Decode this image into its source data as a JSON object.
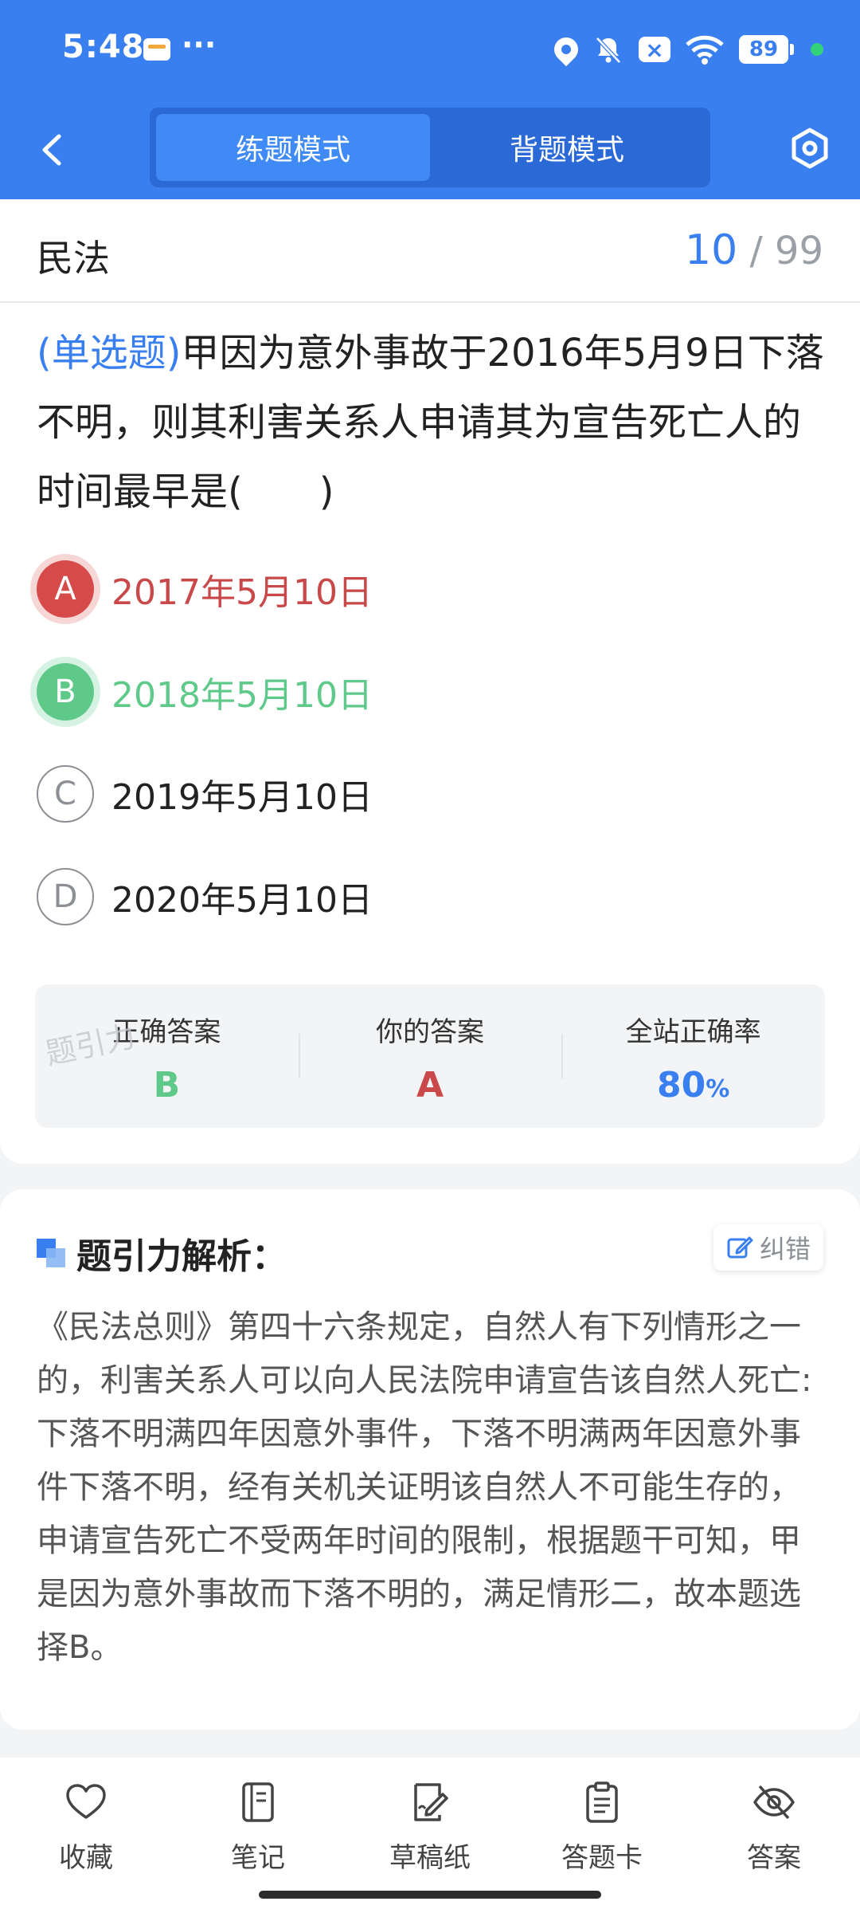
{
  "status_bar": {
    "time": "5:48",
    "more": "···",
    "battery": "89"
  },
  "header": {
    "tabs": [
      {
        "label": "练题模式",
        "active": true
      },
      {
        "label": "背题模式",
        "active": false
      }
    ]
  },
  "question_card": {
    "subject": "民法",
    "progress": {
      "current": "10",
      "separator": "/",
      "total": "99"
    },
    "question_type": "(单选题)",
    "question_text": "甲因为意外事故于2016年5月9日下落不明，则其利害关系人申请其为宣告死亡人的时间最早是(　　)",
    "options": [
      {
        "letter": "A",
        "text": "2017年5月10日",
        "state": "wrong"
      },
      {
        "letter": "B",
        "text": "2018年5月10日",
        "state": "correct"
      },
      {
        "letter": "C",
        "text": "2019年5月10日",
        "state": "none"
      },
      {
        "letter": "D",
        "text": "2020年5月10日",
        "state": "none"
      }
    ],
    "stats": {
      "correct_label": "正确答案",
      "correct_value": "B",
      "yours_label": "你的答案",
      "yours_value": "A",
      "rate_label": "全站正确率",
      "rate_value": "80",
      "rate_unit": "%"
    },
    "watermark": "题引力"
  },
  "analysis": {
    "title": "题引力解析：",
    "fix_label": "纠错",
    "body": "《民法总则》第四十六条规定，自然人有下列情形之一的，利害关系人可以向人民法院申请宣告该自然人死亡:下落不明满四年因意外事件，下落不明满两年因意外事件下落不明，经有关机关证明该自然人不可能生存的，申请宣告死亡不受两年时间的限制，根据题干可知，甲是因为意外事故而下落不明的，满足情形二，故本题选择B。"
  },
  "bottom_nav": [
    {
      "label": "收藏",
      "icon": "heart-icon"
    },
    {
      "label": "笔记",
      "icon": "notebook-icon"
    },
    {
      "label": "草稿纸",
      "icon": "draft-icon"
    },
    {
      "label": "答题卡",
      "icon": "clipboard-icon"
    },
    {
      "label": "答案",
      "icon": "eye-off-icon"
    }
  ],
  "colors": {
    "primary": "#3a7ff0",
    "correct": "#5fc98a",
    "wrong": "#c9484a"
  }
}
